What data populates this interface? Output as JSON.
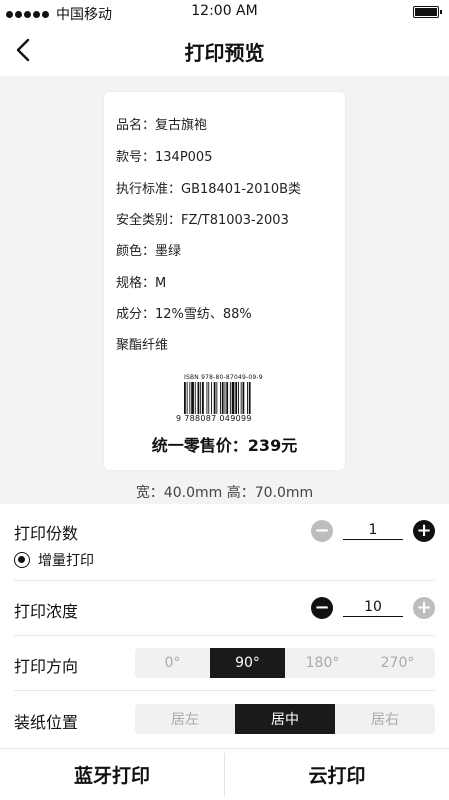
{
  "status_bar": {
    "carrier": "中国移动",
    "time": "12:00 AM",
    "icons": [
      "signal-dots-icon",
      "battery-icon"
    ]
  },
  "nav": {
    "title": "打印预览",
    "back_icon": "chevron-left-icon"
  },
  "label": {
    "lines": [
      "品名：复古旗袍",
      "款号：134P005",
      "执行标准：GB18401-2010B类",
      "安全类别：FZ/T81003-2003",
      "颜色：墨绿",
      "规格：M",
      "成分：12%雪纺、88%",
      "聚酯纤维"
    ],
    "isbn": "ISBN  978-80-87049-09-9",
    "barcode_digits": "9 788087 049099",
    "price": "统一零售价：239元"
  },
  "size_info": "宽：40.0mm   高：70.0mm",
  "copies": {
    "label": "打印份数",
    "value": "1",
    "minus_icon": "minus-circle-icon",
    "plus_icon": "plus-circle-icon",
    "increment_label": "增量打印",
    "increment_selected": true
  },
  "density": {
    "label": "打印浓度",
    "value": "10"
  },
  "direction": {
    "label": "打印方向",
    "options": [
      "0°",
      "90°",
      "180°",
      "270°"
    ],
    "selected": "90°"
  },
  "paper_position": {
    "label": "装纸位置",
    "options": [
      "居左",
      "居中",
      "居右"
    ],
    "selected": "居中"
  },
  "actions": {
    "bluetooth_print": "蓝牙打印",
    "cloud_print": "云打印"
  },
  "colors": {
    "accent": "#1a1a1a",
    "disabled": "#bdbdbd",
    "preview_bg": "#f3f3f3"
  }
}
